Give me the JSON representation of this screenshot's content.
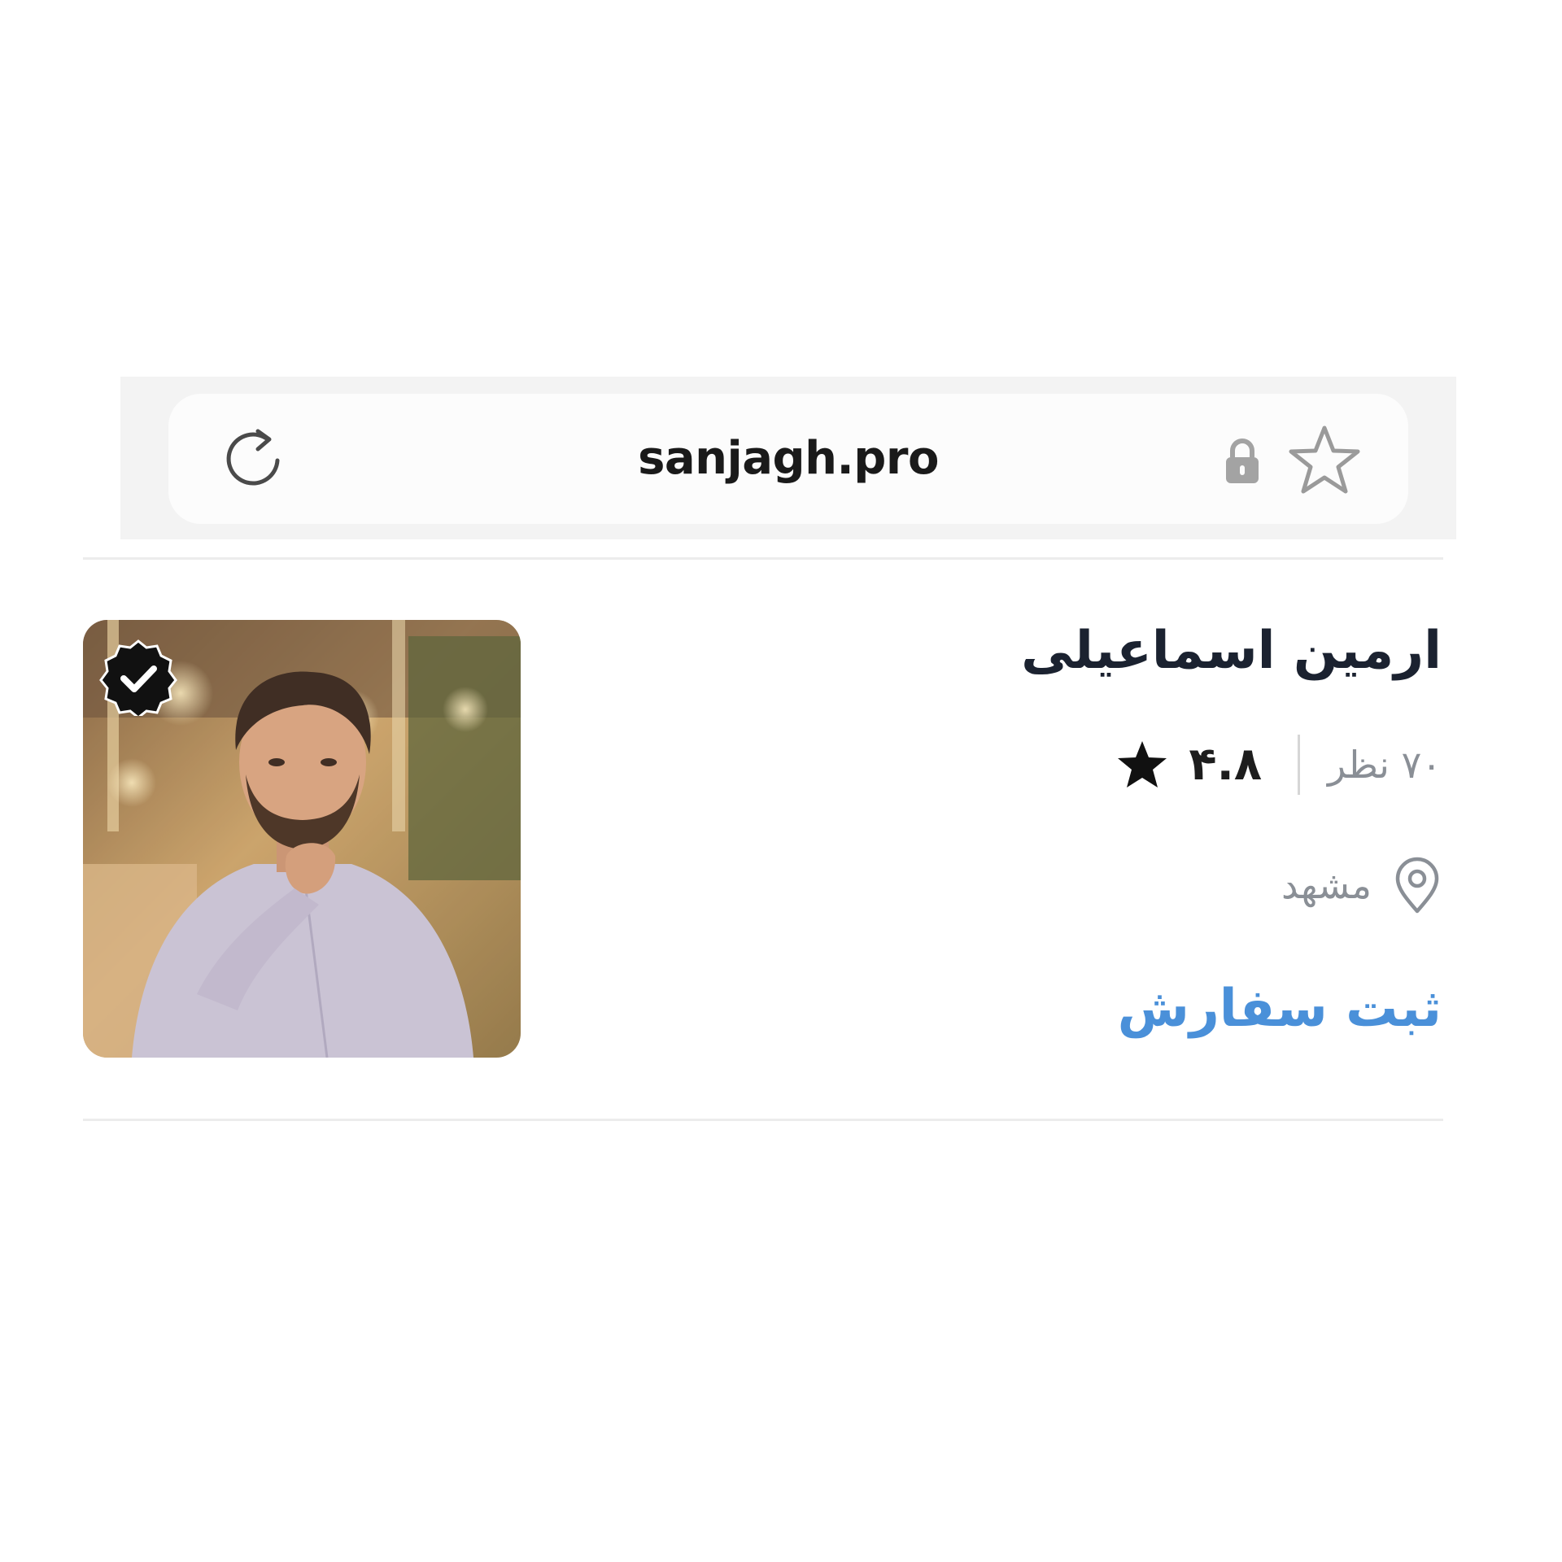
{
  "browser": {
    "url": "sanjagh.pro",
    "reload_icon": "reload-icon",
    "lock_icon": "lock-icon",
    "bookmark_icon": "star-outline-icon"
  },
  "profile": {
    "name": "ارمین اسماعیلی",
    "reviews": "۷۰ نظر",
    "rating": "۴.۸",
    "city": "مشهد",
    "order_label": "ثبت سفارش",
    "verified": true
  },
  "colors": {
    "link": "#4a90d9",
    "muted_text": "#8a8f96",
    "heading": "#1b2230",
    "bar_bg": "#f3f3f3"
  }
}
